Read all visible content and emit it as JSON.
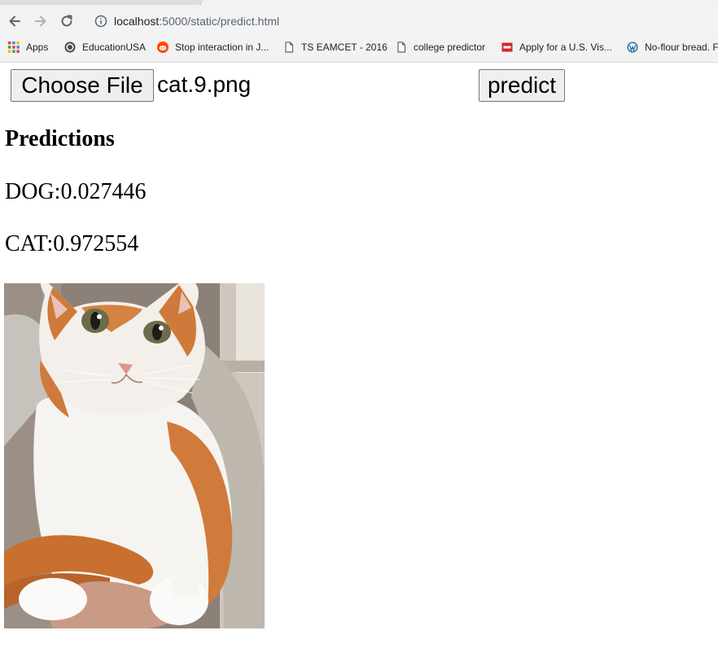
{
  "browser": {
    "url_host": "localhost",
    "url_rest": ":5000/static/predict.html",
    "bookmarks": [
      {
        "label": "Apps",
        "icon": "apps-grid-icon"
      },
      {
        "label": "EducationUSA",
        "icon": "seal-icon"
      },
      {
        "label": "Stop interaction in J...",
        "icon": "reddit-icon"
      },
      {
        "label": "TS EAMCET - 2016",
        "icon": "page-icon"
      },
      {
        "label": "college predictor",
        "icon": "page-icon"
      },
      {
        "label": "Apply for a U.S. Vis...",
        "icon": "cgi-icon"
      },
      {
        "label": "No-flour bread. F",
        "icon": "wordpress-icon"
      }
    ]
  },
  "form": {
    "choose_file_label": "Choose File",
    "file_name": "cat.9.png",
    "predict_label": "predict"
  },
  "results": {
    "heading": "Predictions",
    "dog_line": "DOG:0.027446",
    "cat_line": "CAT:0.972554"
  }
}
